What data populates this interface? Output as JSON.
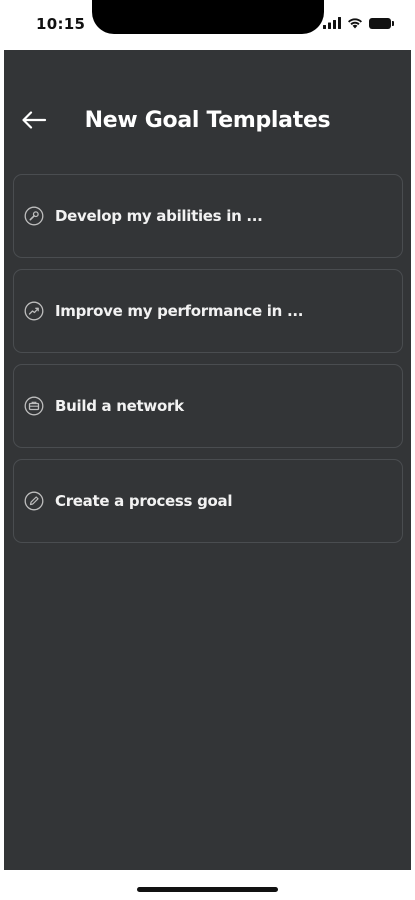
{
  "status_bar": {
    "time": "10:15",
    "icons": [
      "signal-icon",
      "wifi-icon",
      "battery-icon"
    ]
  },
  "header": {
    "back_icon": "arrow-left-icon",
    "title": "New Goal Templates"
  },
  "templates": [
    {
      "label": "Develop my abilities in ...",
      "icon": "wrench-icon"
    },
    {
      "label": "Improve my performance in ...",
      "icon": "trend-up-icon"
    },
    {
      "label": "Build a network",
      "icon": "briefcase-icon"
    },
    {
      "label": "Create a process goal",
      "icon": "pencil-icon"
    }
  ],
  "colors": {
    "background": "#333537",
    "card_border": "#4a4d50",
    "text": "#ffffff",
    "icon": "#bdbdbd"
  }
}
